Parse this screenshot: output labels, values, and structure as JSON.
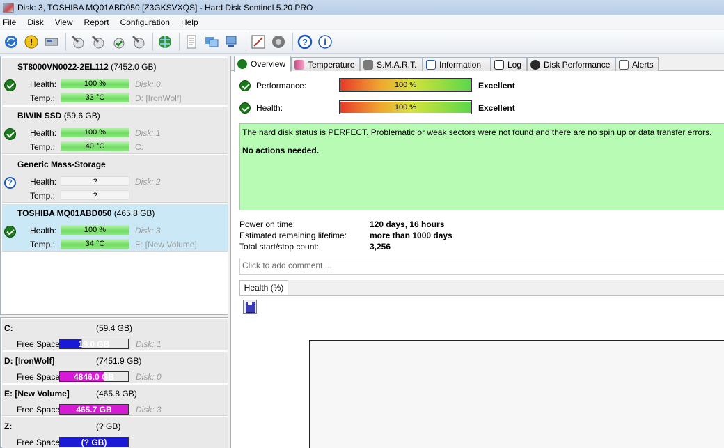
{
  "window": {
    "title": "Disk: 3, TOSHIBA MQ01ABD050 [Z3GKSVXQS]  -  Hard Disk Sentinel 5.20 PRO"
  },
  "menu": [
    "File",
    "Disk",
    "View",
    "Report",
    "Configuration",
    "Help"
  ],
  "toolbar_icons": [
    "refresh-icon",
    "alert-icon",
    "drive-icon",
    "wrench-1-icon",
    "wrench-2-icon",
    "wrench-check-icon",
    "wrench-4-icon",
    "globe-icon",
    "report-icon",
    "sync-icon",
    "network-icon",
    "checklist-icon",
    "speaker-icon",
    "help-icon",
    "info-icon"
  ],
  "disks": [
    {
      "name": "ST8000VN0022-2EL112",
      "capacity": "(7452.0 GB)",
      "health_label": "Health:",
      "health": "100 %",
      "disk": "Disk: 0",
      "temp_label": "Temp.:",
      "temp": "33 °C",
      "volume": "D: [IronWolf]",
      "status": "ok"
    },
    {
      "name": "BIWIN SSD",
      "capacity": "(59.6 GB)",
      "health_label": "Health:",
      "health": "100 %",
      "disk": "Disk: 1",
      "temp_label": "Temp.:",
      "temp": "40 °C",
      "volume": "C:",
      "status": "ok"
    },
    {
      "name": "Generic Mass-Storage",
      "capacity": "",
      "health_label": "Health:",
      "health": "?",
      "disk": "Disk: 2",
      "temp_label": "Temp.:",
      "temp": "?",
      "volume": "",
      "status": "unknown"
    },
    {
      "name": "TOSHIBA MQ01ABD050",
      "capacity": "(465.8 GB)",
      "health_label": "Health:",
      "health": "100 %",
      "disk": "Disk: 3",
      "temp_label": "Temp.:",
      "temp": "34 °C",
      "volume": "E: [New Volume]",
      "status": "ok"
    }
  ],
  "volumes": [
    {
      "name": "C:",
      "capacity": "(59.4 GB)",
      "free_label": "Free Space",
      "free": "19.0 GB",
      "free_fraction": 0.32,
      "bar_color": "#1a1ad6",
      "disk": "Disk: 1"
    },
    {
      "name": "D: [IronWolf]",
      "capacity": "(7451.9 GB)",
      "free_label": "Free Space",
      "free": "4846.0 GB",
      "free_fraction": 0.65,
      "bar_color": "#d61ad6",
      "disk": "Disk: 0"
    },
    {
      "name": "E: [New Volume]",
      "capacity": "(465.8 GB)",
      "free_label": "Free Space",
      "free": "465.7 GB",
      "free_fraction": 1.0,
      "bar_color": "#d61ad6",
      "disk": "Disk: 3"
    },
    {
      "name": "Z:",
      "capacity": "(? GB)",
      "free_label": "Free Space",
      "free": "(? GB)",
      "free_fraction": 1.0,
      "bar_color": "#1a1ad6",
      "disk": ""
    }
  ],
  "tabs": [
    "Overview",
    "Temperature",
    "S.M.A.R.T.",
    "Information",
    "Log",
    "Disk Performance",
    "Alerts"
  ],
  "overview": {
    "performance_label": "Performance:",
    "performance_value": "100 %",
    "performance_rating": "Excellent",
    "health_label": "Health:",
    "health_value": "100 %",
    "health_rating": "Excellent",
    "status_text": "The hard disk status is PERFECT. Problematic or weak sectors were not found and there are no spin up or data transfer errors.",
    "action_text": "No actions needed.",
    "power_on_label": "Power on time:",
    "power_on_value": "120 days, 16 hours",
    "lifetime_label": "Estimated remaining lifetime:",
    "lifetime_value": "more than 1000 days",
    "startstop_label": "Total start/stop count:",
    "startstop_value": "3,256",
    "comment_placeholder": "Click to add comment ...",
    "graph_tab": "Health (%)"
  }
}
